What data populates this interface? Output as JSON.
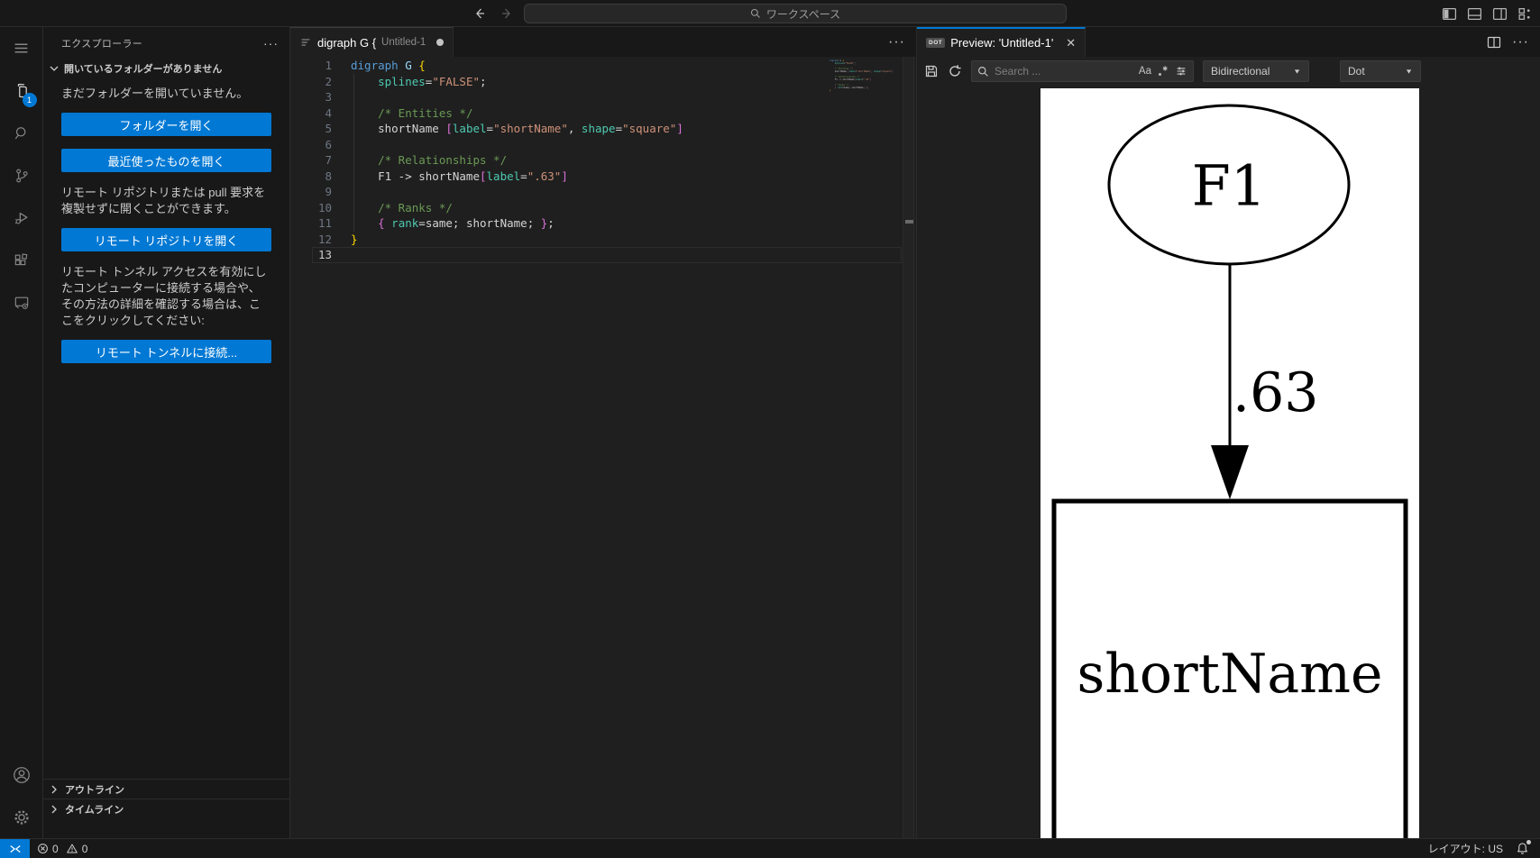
{
  "title_bar": {
    "command_center_label": "ワークスペース"
  },
  "activity_bar": {
    "explorer_badge": "1"
  },
  "sidebar": {
    "title": "エクスプローラー",
    "section_header": "開いているフォルダーがありません",
    "no_folder_text": "まだフォルダーを開いていません。",
    "open_folder_button": "フォルダーを開く",
    "open_recent_button": "最近使ったものを開く",
    "remote_repo_text": "リモート リポジトリまたは pull 要求を複製せずに開くことができます。",
    "open_remote_repo_button": "リモート リポジトリを開く",
    "tunnel_text": "リモート トンネル アクセスを有効にしたコンピューターに接続する場合や、その方法の詳細を確認する場合は、ここをクリックしてください:",
    "connect_tunnel_button": "リモート トンネルに接続...",
    "outline_pane": "アウトライン",
    "timeline_pane": "タイムライン"
  },
  "editor": {
    "tab_title": "digraph G {",
    "tab_file": "Untitled-1",
    "active_line": 13,
    "token_colors": {
      "kw": "#569CD6",
      "var": "#9CDCFE",
      "attr": "#4EC9B0",
      "str": "#CE9178",
      "cmt": "#6A9955",
      "b1": "#FFD700",
      "b2": "#DA70D6",
      "d": "#D4D4D4"
    },
    "lines": [
      [
        [
          "kw",
          "digraph"
        ],
        [
          "d",
          " "
        ],
        [
          "var",
          "G"
        ],
        [
          "d",
          " "
        ],
        [
          "b1",
          "{"
        ]
      ],
      [
        [
          "d",
          "    "
        ],
        [
          "attr",
          "splines"
        ],
        [
          "d",
          "="
        ],
        [
          "str",
          "\"FALSE\""
        ],
        [
          "d",
          ";"
        ]
      ],
      [],
      [
        [
          "d",
          "    "
        ],
        [
          "cmt",
          "/* Entities */"
        ]
      ],
      [
        [
          "d",
          "    shortName "
        ],
        [
          "b2",
          "["
        ],
        [
          "attr",
          "label"
        ],
        [
          "d",
          "="
        ],
        [
          "str",
          "\"shortName\""
        ],
        [
          "d",
          ", "
        ],
        [
          "attr",
          "shape"
        ],
        [
          "d",
          "="
        ],
        [
          "str",
          "\"square\""
        ],
        [
          "b2",
          "]"
        ]
      ],
      [],
      [
        [
          "d",
          "    "
        ],
        [
          "cmt",
          "/* Relationships */"
        ]
      ],
      [
        [
          "d",
          "    F1 -> shortName"
        ],
        [
          "b2",
          "["
        ],
        [
          "attr",
          "label"
        ],
        [
          "d",
          "="
        ],
        [
          "str",
          "\".63\""
        ],
        [
          "b2",
          "]"
        ]
      ],
      [],
      [
        [
          "d",
          "    "
        ],
        [
          "cmt",
          "/* Ranks */"
        ]
      ],
      [
        [
          "d",
          "    "
        ],
        [
          "b2",
          "{"
        ],
        [
          "d",
          " "
        ],
        [
          "attr",
          "rank"
        ],
        [
          "d",
          "="
        ],
        [
          "d",
          "same"
        ],
        [
          "d",
          "; shortName; "
        ],
        [
          "b2",
          "}"
        ],
        [
          "d",
          ";"
        ]
      ],
      [
        [
          "b1",
          "}"
        ]
      ],
      []
    ]
  },
  "preview": {
    "tab_label": "Preview: 'Untitled-1'",
    "tab_badge": "DOT",
    "search_placeholder": "Search ...",
    "match_case_label": "Aa",
    "regex_label": ".*",
    "direction_dropdown": "Bidirectional",
    "engine_dropdown": "Dot",
    "graph": {
      "node_f1": "F1",
      "edge_label": ".63",
      "node_shortname": "shortName"
    }
  },
  "status_bar": {
    "errors": "0",
    "warnings": "0",
    "layout_label": "レイアウト: US"
  },
  "colors": {
    "accent": "#0078d4",
    "background": "#1f1f1f",
    "panel": "#181818",
    "border": "#2b2b2b"
  }
}
